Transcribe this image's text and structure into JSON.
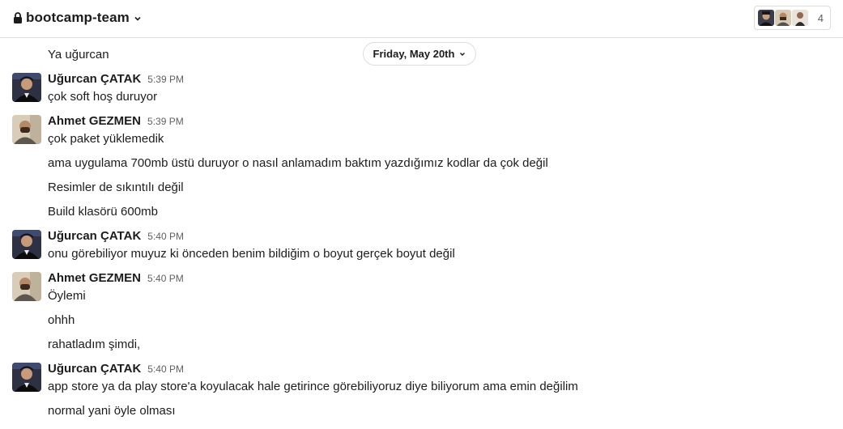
{
  "channel": {
    "name": "bootcamp-team",
    "member_count": "4"
  },
  "date_divider": {
    "label": "Friday, May 20th"
  },
  "messages": [
    {
      "kind": "continuation",
      "text": "Ya uğurcan"
    },
    {
      "kind": "header",
      "sender": "Uğurcan ÇATAK",
      "time": "5:39 PM",
      "text": "çok soft hoş duruyor",
      "avatar": "ugurcan"
    },
    {
      "kind": "header",
      "sender": "Ahmet GEZMEN",
      "time": "5:39 PM",
      "text": "çok paket yüklemedik",
      "avatar": "ahmet"
    },
    {
      "kind": "continuation",
      "text": "ama uygulama 700mb üstü duruyor o nasıl anlamadım baktım yazdığımız kodlar da çok değil"
    },
    {
      "kind": "continuation",
      "text": "Resimler de sıkıntılı değil"
    },
    {
      "kind": "continuation",
      "text": "Build klasörü 600mb"
    },
    {
      "kind": "header",
      "sender": "Uğurcan ÇATAK",
      "time": "5:40 PM",
      "text": "onu görebiliyor muyuz ki önceden benim bildiğim o boyut gerçek boyut değil",
      "avatar": "ugurcan"
    },
    {
      "kind": "header",
      "sender": "Ahmet GEZMEN",
      "time": "5:40 PM",
      "text": "Öylemi",
      "avatar": "ahmet"
    },
    {
      "kind": "continuation",
      "text": "ohhh"
    },
    {
      "kind": "continuation",
      "text": "rahatladım şimdi,"
    },
    {
      "kind": "header",
      "sender": "Uğurcan ÇATAK",
      "time": "5:40 PM",
      "text": "app store ya da play store'a koyulacak hale getirince görebiliyoruz diye biliyorum ama emin değilim",
      "avatar": "ugurcan"
    },
    {
      "kind": "continuation",
      "text": "normal yani öyle olması"
    }
  ],
  "icons": {
    "lock": "lock-icon",
    "channel_chevron": "chevron-down-icon",
    "date_chevron": "chevron-down-icon"
  },
  "colors": {
    "text": "#1d1c1d",
    "muted": "#616061",
    "border": "#dddddd",
    "background": "#ffffff"
  }
}
